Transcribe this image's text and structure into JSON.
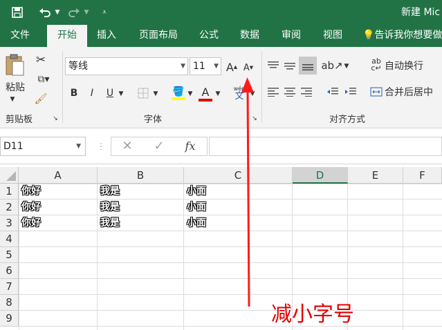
{
  "titlebar": {
    "save_icon": "save-icon",
    "undo_icon": "undo-icon",
    "redo_icon": "redo-icon",
    "customize_icon": "customize-icon",
    "title": "新建 Mic"
  },
  "tabs": [
    "文件",
    "开始",
    "插入",
    "页面布局",
    "公式",
    "数据",
    "审阅",
    "视图"
  ],
  "active_tab": "开始",
  "tell_me": "告诉我你想要做",
  "ribbon": {
    "clipboard": {
      "paste": "粘贴",
      "label": "剪贴板"
    },
    "font": {
      "font_name": "等线",
      "font_size": "11",
      "grow_font": "A",
      "shrink_font": "A",
      "bold": "B",
      "italic": "I",
      "underline": "U",
      "font_color_letter": "A",
      "phonetic_top": "wén",
      "phonetic_bottom": "文",
      "label": "字体"
    },
    "alignment": {
      "wrap_text": "自动换行",
      "merge_center": "合并后居中",
      "label": "对齐方式"
    }
  },
  "formula_bar": {
    "name_box": "D11",
    "fx": "fx",
    "value": ""
  },
  "columns": [
    "A",
    "B",
    "C",
    "D",
    "E",
    "F"
  ],
  "rows": [
    "1",
    "2",
    "3",
    "4",
    "5",
    "6",
    "7",
    "8",
    "9"
  ],
  "cells": [
    [
      "你好",
      "我是",
      "小面"
    ],
    [
      "你好",
      "我是",
      "小面"
    ],
    [
      "你好",
      "我是",
      "小面"
    ]
  ],
  "annotation": "减小字号",
  "colors": {
    "brand": "#217346",
    "annotation": "#e00000",
    "highlight": "#ffff00",
    "font_color": "#e00000"
  }
}
